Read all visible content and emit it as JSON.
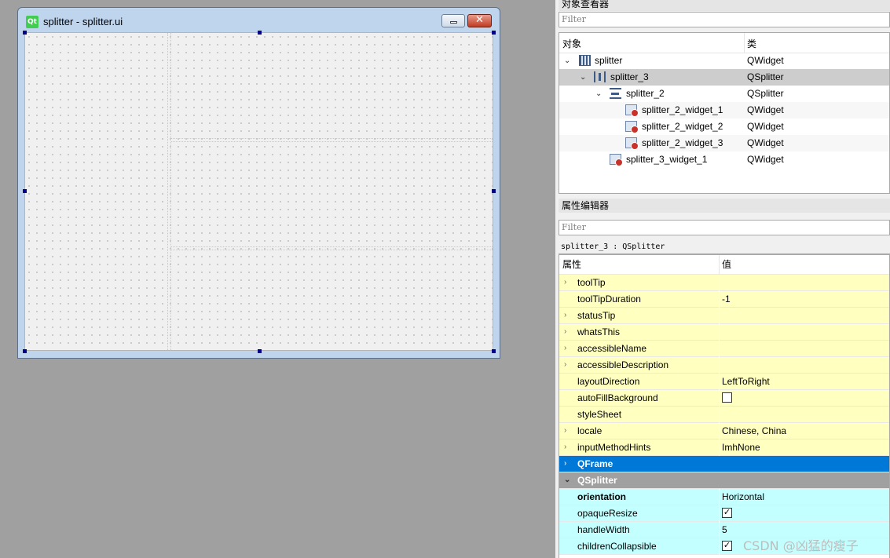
{
  "form_window": {
    "title": "splitter - splitter.ui",
    "logo_text": "Qt",
    "minimize_symbol": "",
    "close_symbol": "✕"
  },
  "object_inspector": {
    "title": "对象查看器",
    "filter_placeholder": "Filter",
    "columns": [
      "对象",
      "类"
    ],
    "rows": [
      {
        "name": "splitter",
        "class": "QWidget",
        "arrow": "⌄"
      },
      {
        "name": "splitter_3",
        "class": "QSplitter",
        "arrow": "⌄"
      },
      {
        "name": "splitter_2",
        "class": "QSplitter",
        "arrow": "⌄"
      },
      {
        "name": "splitter_2_widget_1",
        "class": "QWidget",
        "arrow": ""
      },
      {
        "name": "splitter_2_widget_2",
        "class": "QWidget",
        "arrow": ""
      },
      {
        "name": "splitter_2_widget_3",
        "class": "QWidget",
        "arrow": ""
      },
      {
        "name": "splitter_3_widget_1",
        "class": "QWidget",
        "arrow": ""
      }
    ]
  },
  "property_editor": {
    "title": "属性编辑器",
    "filter_placeholder": "Filter",
    "class_line": "splitter_3 : QSplitter",
    "columns": [
      "属性",
      "值"
    ],
    "rows": [
      {
        "arrow": "›",
        "name": "toolTip",
        "value": ""
      },
      {
        "arrow": "",
        "name": "toolTipDuration",
        "value": "-1"
      },
      {
        "arrow": "›",
        "name": "statusTip",
        "value": ""
      },
      {
        "arrow": "›",
        "name": "whatsThis",
        "value": ""
      },
      {
        "arrow": "›",
        "name": "accessibleName",
        "value": ""
      },
      {
        "arrow": "›",
        "name": "accessibleDescription",
        "value": ""
      },
      {
        "arrow": "",
        "name": "layoutDirection",
        "value": "LeftToRight"
      },
      {
        "arrow": "",
        "name": "autoFillBackground",
        "value": ""
      },
      {
        "arrow": "",
        "name": "styleSheet",
        "value": ""
      },
      {
        "arrow": "›",
        "name": "locale",
        "value": "Chinese, China"
      },
      {
        "arrow": "›",
        "name": "inputMethodHints",
        "value": "ImhNone"
      },
      {
        "arrow": "›",
        "name": "QFrame",
        "value": ""
      },
      {
        "arrow": "⌄",
        "name": "QSplitter",
        "value": ""
      },
      {
        "arrow": "",
        "name": "orientation",
        "value": "Horizontal"
      },
      {
        "arrow": "",
        "name": "opaqueResize",
        "value": ""
      },
      {
        "arrow": "",
        "name": "handleWidth",
        "value": "5"
      },
      {
        "arrow": "",
        "name": "childrenCollapsible",
        "value": ""
      }
    ],
    "checkbox_states": {
      "autoFillBackground": false,
      "opaqueResize": true,
      "childrenCollapsible": true
    },
    "checkmark": "✓"
  },
  "watermark": "CSDN @凶猛的瘦子"
}
